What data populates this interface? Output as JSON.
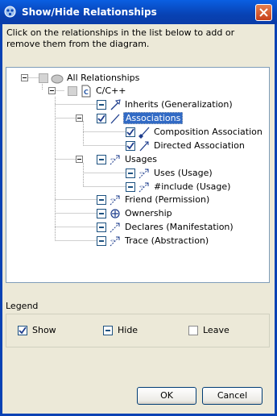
{
  "window": {
    "title": "Show/Hide Relationships"
  },
  "instructions": "Click on the relationships in the list below to add or remove them from the diagram.",
  "tree": {
    "root": "All Relationships",
    "cpp": "C/C++",
    "inherits": "Inherits (Generalization)",
    "associations": "Associations",
    "composition": "Composition Association",
    "directed": "Directed Association",
    "usages": "Usages",
    "uses": "Uses (Usage)",
    "include": "#include (Usage)",
    "friend": "Friend (Permission)",
    "ownership": "Ownership",
    "declares": "Declares (Manifestation)",
    "trace": "Trace (Abstraction)"
  },
  "legend": {
    "caption": "Legend",
    "show": "Show",
    "hide": "Hide",
    "leave": "Leave"
  },
  "buttons": {
    "ok": "OK",
    "cancel": "Cancel"
  }
}
